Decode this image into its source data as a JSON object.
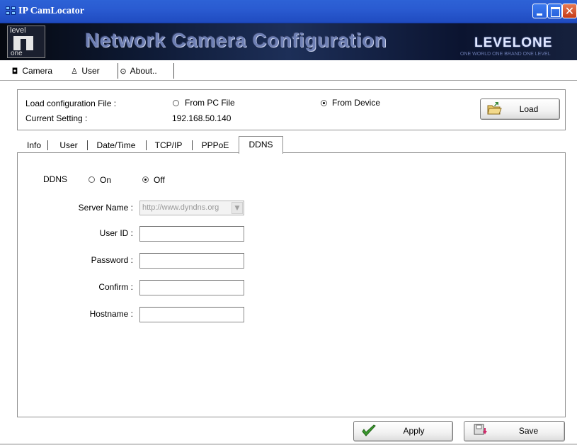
{
  "window": {
    "title": "IP CamLocator"
  },
  "banner": {
    "title": "Network Camera Configuration",
    "brand": "LEVELONE",
    "brand_tagline": "ONE WORLD ONE BRAND ONE LEVEL",
    "logo_top": "level",
    "logo_bottom": "one"
  },
  "top_tabs": [
    {
      "label": "Camera",
      "icon": "camera-icon"
    },
    {
      "label": "User",
      "icon": "user-icon"
    },
    {
      "label": "About..",
      "icon": "info-icon"
    }
  ],
  "config": {
    "load_label": "Load configuration File :",
    "current_label": "Current Setting :",
    "current_value": "192.168.50.140",
    "from_pc": "From PC File",
    "from_device": "From Device",
    "selected_source": "From Device",
    "load_button": "Load"
  },
  "inner_tabs": [
    "Info",
    "User",
    "Date/Time",
    "TCP/IP",
    "PPPoE",
    "DDNS"
  ],
  "active_inner_tab": "DDNS",
  "ddns": {
    "label": "DDNS",
    "on_label": "On",
    "off_label": "Off",
    "selected": "Off",
    "server_name_label": "Server Name :",
    "server_name_value": "http://www.dyndns.org",
    "user_id_label": "User ID :",
    "user_id_value": "",
    "password_label": "Password :",
    "password_value": "",
    "confirm_label": "Confirm :",
    "confirm_value": "",
    "hostname_label": "Hostname :",
    "hostname_value": ""
  },
  "actions": {
    "apply": "Apply",
    "save": "Save"
  }
}
